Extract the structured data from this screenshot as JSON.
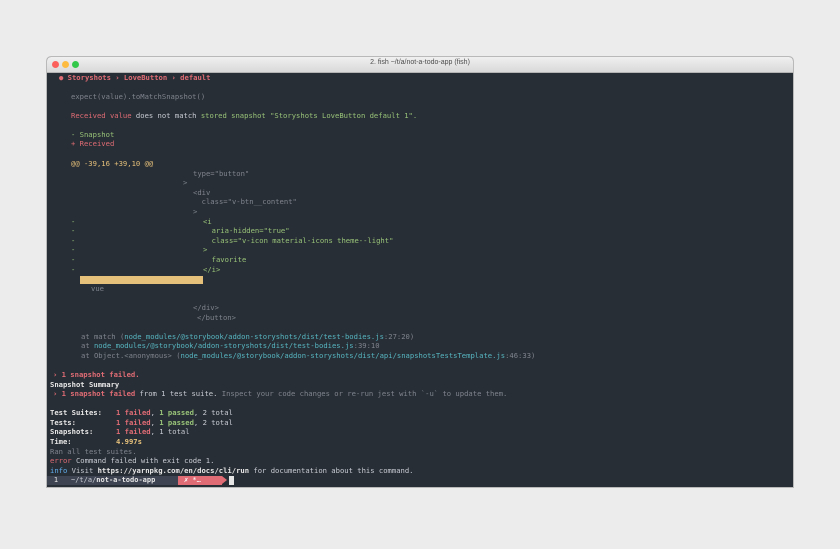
{
  "window": {
    "title": "2. fish ~/t/a/not-a-todo-app (fish)"
  },
  "test": {
    "header": "● Storyshots › LoveButton › default",
    "expect": "expect(value).toMatchSnapshot()",
    "received_a": "Received value",
    "received_b": " does not match ",
    "received_c": "stored snapshot \"Storyshots LoveButton default 1\".",
    "snapshot_label": "- Snapshot",
    "received_label": "+ Received",
    "hunk": "@@ -39,16 +39,10 @@",
    "diff": [
      {
        "marker": "",
        "text": "type=\"button\""
      },
      {
        "marker": "",
        "text": ">"
      },
      {
        "marker": "",
        "text": "<div"
      },
      {
        "marker": "",
        "text": "  class=\"v-btn__content\""
      },
      {
        "marker": "",
        "text": ">"
      },
      {
        "marker": "-",
        "text": "<i"
      },
      {
        "marker": "-",
        "text": "  aria-hidden=\"true\""
      },
      {
        "marker": "-",
        "text": "  class=\"v-icon material-icons theme--light\""
      },
      {
        "marker": "-",
        "text": ">"
      },
      {
        "marker": "-",
        "text": "  favorite"
      },
      {
        "marker": "-",
        "text": "</i>"
      },
      {
        "marker": "",
        "text": "vue"
      },
      {
        "marker": "",
        "text": "</div>"
      },
      {
        "marker": "",
        "text": "</button>"
      }
    ],
    "stack": [
      {
        "pre": "at match (",
        "path": "node_modules/@storybook/addon-storyshots/dist/test-bodies.js",
        "loc": ":27:20)"
      },
      {
        "pre": "at ",
        "path": "node_modules/@storybook/addon-storyshots/dist/test-bodies.js",
        "loc": ":39:10"
      },
      {
        "pre": "at Object.<anonymous> (",
        "path": "node_modules/@storybook/addon-storyshots/dist/api/snapshotsTestsTemplate.js",
        "loc": ":46:33)"
      }
    ]
  },
  "summary": {
    "failed_line": "› 1 snapshot failed.",
    "snapshot_summary": "Snapshot Summary",
    "failed_suite_a": "› 1 snapshot failed",
    "failed_suite_b": " from 1 test suite.",
    "failed_suite_c": " Inspect your code changes or re-run jest with `-u` to update them.",
    "rows": [
      {
        "label": "Test Suites:",
        "failed": "1 failed",
        "passed": "1 passed",
        "total": "2 total"
      },
      {
        "label": "Tests:",
        "failed": "1 failed",
        "passed": "1 passed",
        "total": "2 total"
      },
      {
        "label": "Snapshots:",
        "failed": "1 failed",
        "passed": "",
        "total": "1 total"
      }
    ],
    "time_label": "Time:",
    "time_value": "4.997s",
    "ran_all": "Ran all test suites.",
    "error_tag": "error",
    "error_text": " Command failed with exit code 1.",
    "info_tag": "info",
    "info_a": " Visit ",
    "info_url": "https://yarnpkg.com/en/docs/cli/run",
    "info_b": " for documentation about this command."
  },
  "prompt": {
    "number": "1",
    "path": "~/t/a/",
    "dir": "not-a-todo-app",
    "status": "✗ *…"
  }
}
